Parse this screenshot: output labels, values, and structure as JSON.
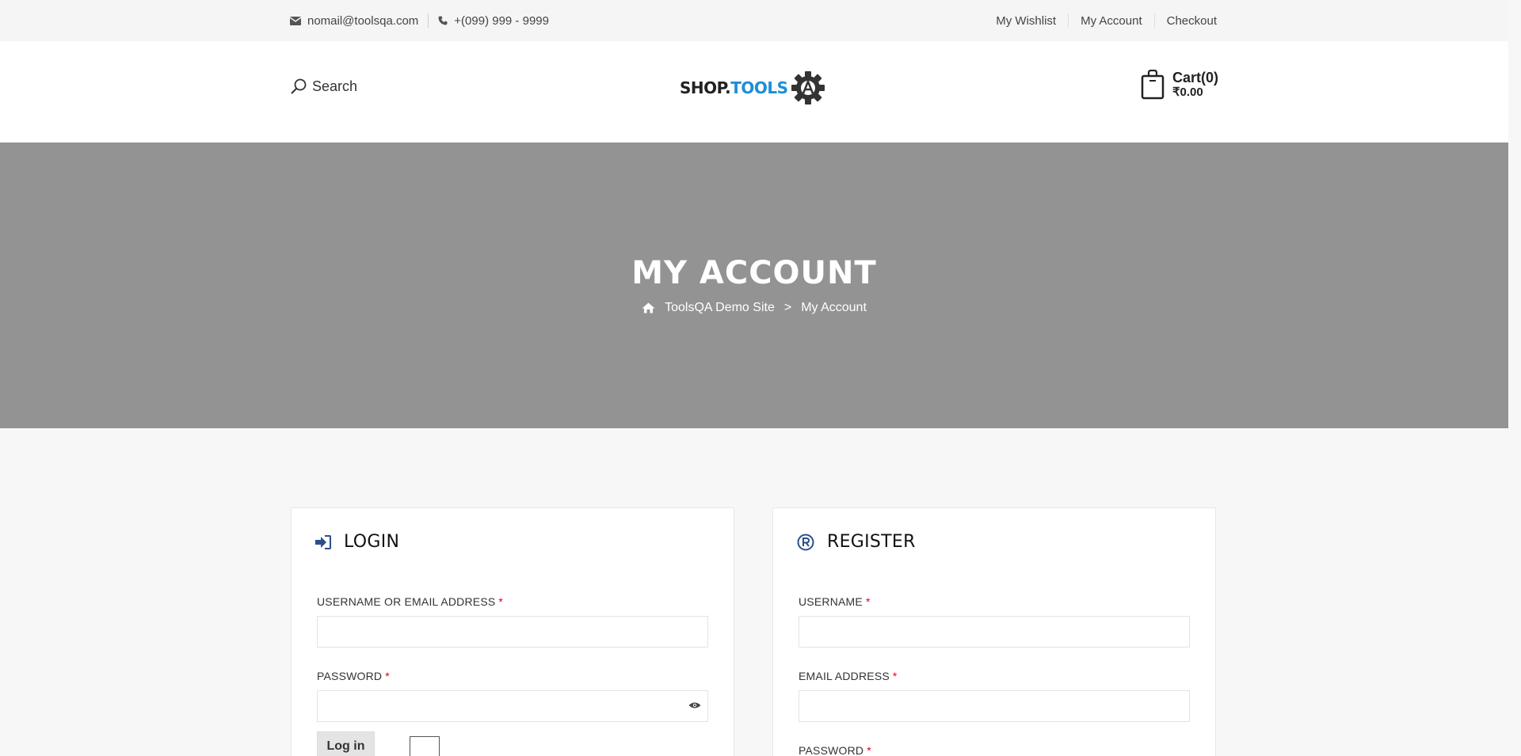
{
  "topbar": {
    "email": "nomail@toolsqa.com",
    "phone": "+(099) 999 - 9999",
    "links": [
      "My Wishlist",
      "My Account",
      "Checkout"
    ]
  },
  "header": {
    "search_label": "Search",
    "logo_part1": "SHOP.",
    "logo_part2": "TOOLS",
    "logo_icon": "gear-icon",
    "cart_title": "Cart(0)",
    "cart_amount": "₹0.00"
  },
  "banner": {
    "title": "MY ACCOUNT",
    "breadcrumb_home": "ToolsQA Demo Site",
    "breadcrumb_sep": ">",
    "breadcrumb_current": "My Account"
  },
  "login": {
    "title": "LOGIN",
    "username_label": "USERNAME OR EMAIL ADDRESS",
    "password_label": "PASSWORD",
    "required_mark": "*",
    "username_value": "",
    "password_value": "",
    "submit_label": "Log in"
  },
  "register": {
    "title": "REGISTER",
    "username_label": "USERNAME",
    "email_label": "EMAIL ADDRESS",
    "password_label": "PASSWORD",
    "required_mark": "*",
    "username_value": "",
    "email_value": ""
  },
  "colors": {
    "accent": "#1e8ed8",
    "banner_bg": "#939393",
    "required": "#e0001b",
    "panel_icon": "#2b4f8a"
  }
}
